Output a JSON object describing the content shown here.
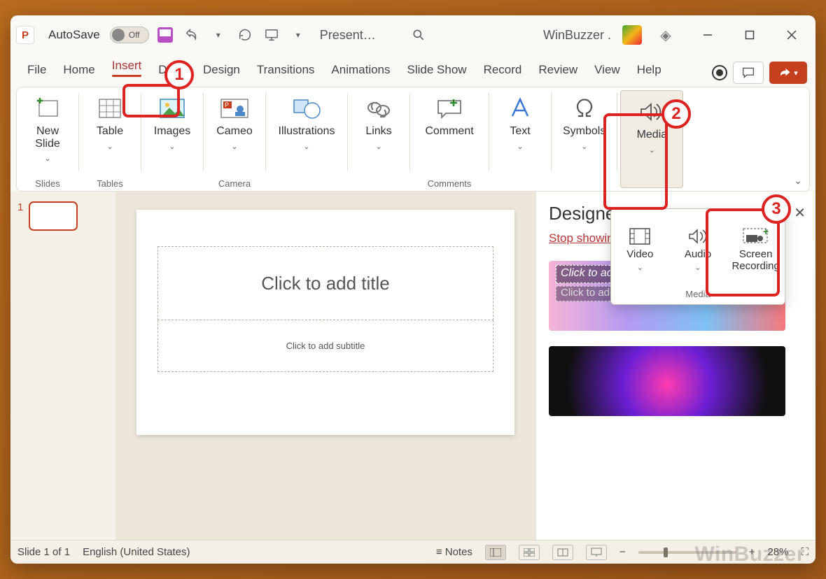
{
  "app": {
    "letter": "P",
    "autosave_label": "AutoSave",
    "autosave_state": "Off",
    "doc_title": "Present…",
    "user_text": "WinBuzzer ."
  },
  "tabs": {
    "items": [
      "File",
      "Home",
      "Insert",
      "Draw",
      "Design",
      "Transitions",
      "Animations",
      "Slide Show",
      "Record",
      "Review",
      "View",
      "Help"
    ],
    "active": "Insert"
  },
  "ribbon": {
    "groups": [
      {
        "caption": "Slides",
        "buttons": [
          {
            "label": "New\nSlide",
            "chev": true
          }
        ]
      },
      {
        "caption": "Tables",
        "buttons": [
          {
            "label": "Table",
            "chev": true
          }
        ]
      },
      {
        "caption": "",
        "buttons": [
          {
            "label": "Images",
            "chev": true
          }
        ]
      },
      {
        "caption": "Camera",
        "buttons": [
          {
            "label": "Cameo",
            "chev": true
          }
        ]
      },
      {
        "caption": "",
        "buttons": [
          {
            "label": "Illustrations",
            "chev": true
          }
        ]
      },
      {
        "caption": "",
        "buttons": [
          {
            "label": "Links",
            "chev": true
          }
        ]
      },
      {
        "caption": "Comments",
        "buttons": [
          {
            "label": "Comment",
            "chev": false
          }
        ]
      },
      {
        "caption": "",
        "buttons": [
          {
            "label": "Text",
            "chev": true
          }
        ]
      },
      {
        "caption": "",
        "buttons": [
          {
            "label": "Symbols",
            "chev": true
          }
        ]
      },
      {
        "caption": "",
        "buttons": [
          {
            "label": "Media",
            "chev": true,
            "highlight": true
          }
        ]
      }
    ]
  },
  "media_popup": {
    "items": [
      {
        "label": "Video",
        "chev": true
      },
      {
        "label": "Audio",
        "chev": true
      },
      {
        "label": "Screen\nRecording",
        "chev": false,
        "highlight": true
      }
    ],
    "caption": "Media"
  },
  "thumbs": {
    "slides": [
      {
        "num": "1"
      }
    ]
  },
  "slide": {
    "title_placeholder": "Click to add title",
    "subtitle_placeholder": "Click to add subtitle"
  },
  "designer": {
    "heading": "Designer",
    "stop_link": "Stop showing ideas for new presentations",
    "sugg_title": "Click to add title",
    "sugg_sub": "Click to add subtitle"
  },
  "status": {
    "slide_info": "Slide 1 of 1",
    "language": "English (United States)",
    "notes": "Notes",
    "zoom_pct": "28%"
  },
  "callouts": {
    "c1": "1",
    "c2": "2",
    "c3": "3"
  },
  "watermark": "WinBuzzer"
}
